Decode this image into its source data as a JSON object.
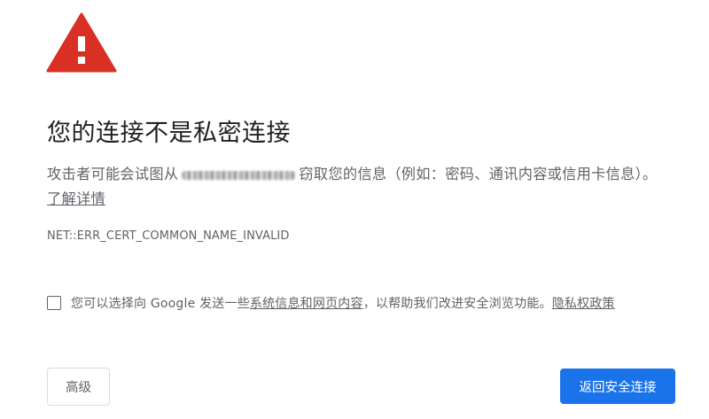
{
  "icons": {
    "warning": "warning-triangle-icon"
  },
  "colors": {
    "warning_red": "#d93025",
    "primary_blue": "#1a73e8",
    "text_secondary": "#5f6368"
  },
  "title": "您的连接不是私密连接",
  "message": {
    "before_host": "攻击者可能会试图从",
    "after_host": "窃取您的信息（例如：密码、通讯内容或信用卡信息）。",
    "learn_more": "了解详情"
  },
  "error_code": "NET::ERR_CERT_COMMON_NAME_INVALID",
  "optin": {
    "checked": false,
    "before_link": "您可以选择向 Google 发送一些",
    "link": "系统信息和网页内容",
    "middle": "，以帮助我们改进安全浏览功能。",
    "privacy_link": "隐私权政策"
  },
  "buttons": {
    "advanced": "高级",
    "back_to_safety": "返回安全连接"
  }
}
